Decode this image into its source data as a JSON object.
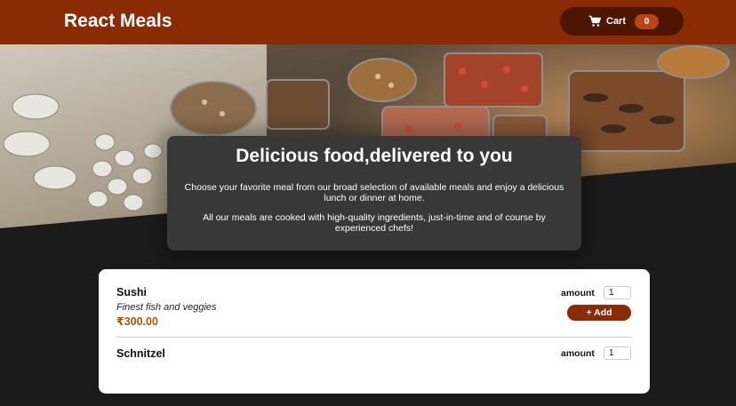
{
  "header": {
    "title": "React Meals",
    "cart": {
      "label": "Cart",
      "count": "0",
      "icon": "cart-icon"
    }
  },
  "colors": {
    "header_bg": "#8a2b06",
    "cart_bg": "#4d1601",
    "badge_bg": "#b94517",
    "page_bg": "#1b1b1b",
    "summary_bg": "#383838",
    "price": "#ad5502"
  },
  "hero": {
    "image": "buffet-food-table"
  },
  "summary": {
    "title": "Delicious food,delivered to you",
    "paragraph1": "Choose your favorite meal from our broad selection of available meals and enjoy a delicious lunch or dinner at home.",
    "paragraph2": "All our meals are cooked with high-quality ingredients, just-in-time and of course by experienced chefs!"
  },
  "meals": [
    {
      "name": "Sushi",
      "description": "Finest fish and veggies",
      "price": "₹300.00",
      "amount_label": "amount",
      "amount": "1",
      "add_label": "+ Add"
    },
    {
      "name": "Schnitzel",
      "amount_label": "amount",
      "amount": "1"
    }
  ]
}
